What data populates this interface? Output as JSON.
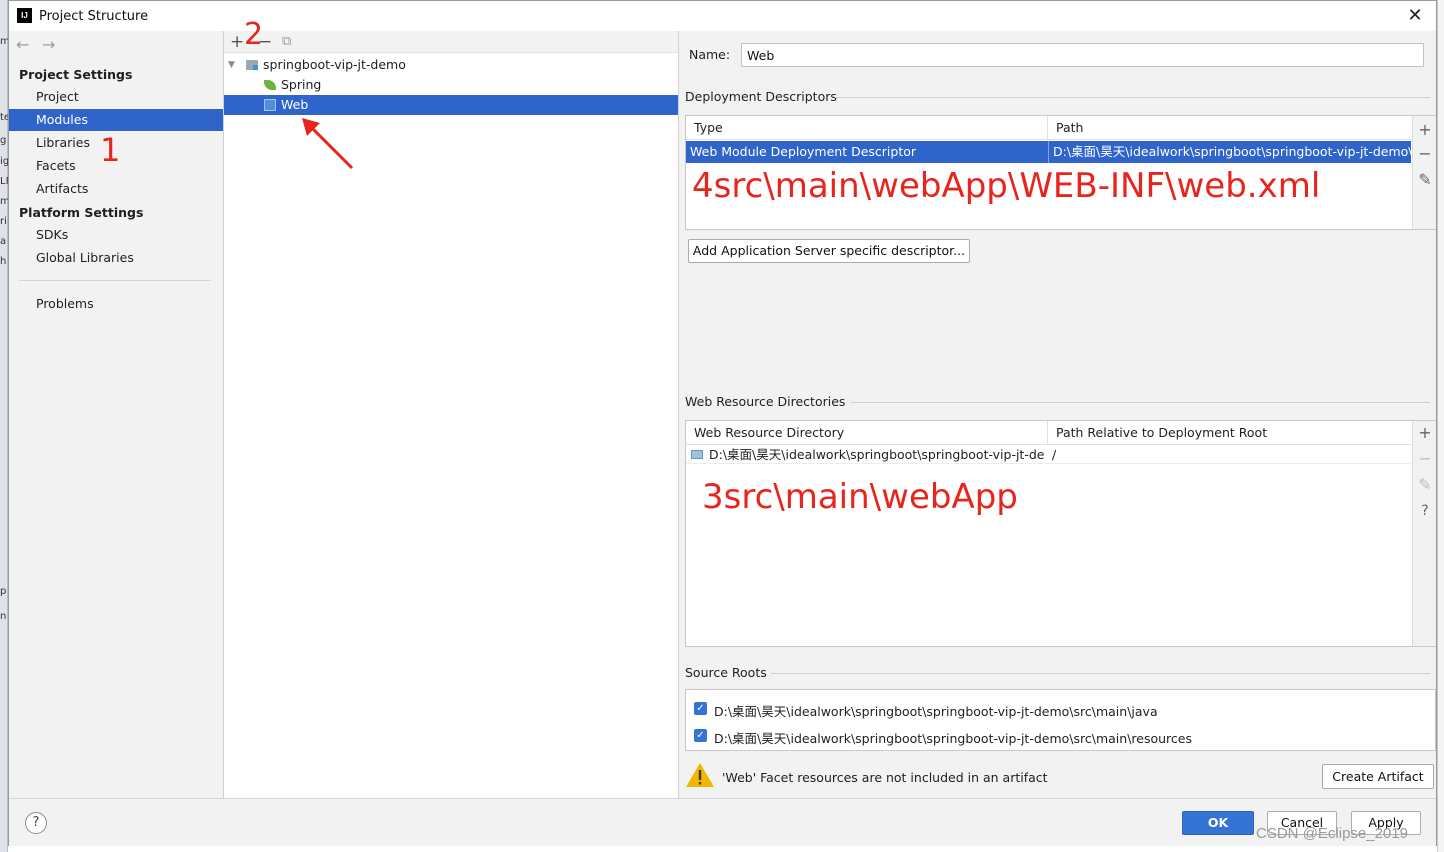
{
  "window": {
    "title": "Project Structure",
    "app_logo": "IJ",
    "close_glyph": "✕"
  },
  "nav": {
    "back_glyph": "←",
    "forward_glyph": "→",
    "project_settings_header": "Project Settings",
    "project_settings_items": [
      "Project",
      "Modules",
      "Libraries",
      "Facets",
      "Artifacts"
    ],
    "platform_settings_header": "Platform Settings",
    "platform_settings_items": [
      "SDKs",
      "Global Libraries"
    ],
    "problems": "Problems",
    "selected": "Modules"
  },
  "tree": {
    "toolbar": {
      "add_glyph": "+",
      "remove_glyph": "−",
      "copy_glyph": "⧉"
    },
    "root": "springboot-vip-jt-demo",
    "children": [
      "Spring",
      "Web"
    ],
    "selected": "Web"
  },
  "details": {
    "name_label": "Name:",
    "name_value": "Web",
    "deployment_descriptors": {
      "section_title": "Deployment Descriptors",
      "columns": [
        "Type",
        "Path"
      ],
      "rows": [
        {
          "type": "Web Module Deployment Descriptor",
          "path": "D:\\桌面\\昊天\\idealwork\\springboot\\springboot-vip-jt-demo\\src\\main\\webApp\\WEB-INF\\web.xml"
        }
      ],
      "add_descriptor_button": "Add Application Server specific descriptor..."
    },
    "web_resource_directories": {
      "section_title": "Web Resource Directories",
      "columns": [
        "Web Resource Directory",
        "Path Relative to Deployment Root"
      ],
      "rows": [
        {
          "directory": "D:\\桌面\\昊天\\idealwork\\springboot\\springboot-vip-jt-de...",
          "relative": "/"
        }
      ]
    },
    "source_roots": {
      "section_title": "Source Roots",
      "items": [
        {
          "path": "D:\\桌面\\昊天\\idealwork\\springboot\\springboot-vip-jt-demo\\src\\main\\java",
          "checked": true
        },
        {
          "path": "D:\\桌面\\昊天\\idealwork\\springboot\\springboot-vip-jt-demo\\src\\main\\resources",
          "checked": true
        }
      ]
    },
    "warning_text": "'Web' Facet resources are not included in an artifact",
    "create_artifact_button": "Create Artifact"
  },
  "side_tools": {
    "add": "+",
    "remove": "−",
    "edit": "✎",
    "help": "?"
  },
  "footer": {
    "help_glyph": "?",
    "ok": "OK",
    "cancel": "Cancel",
    "apply": "Apply"
  },
  "annotations": {
    "step1": "1",
    "step2": "2",
    "step3": "3src\\main\\webApp",
    "step4": "4src\\main\\webApp\\WEB-INF\\web.xml",
    "color": "#e8241c"
  },
  "watermark": "CSDN @Eclipse_2019",
  "colors": {
    "selection": "#2f65ca",
    "primary_button": "#3574d4",
    "warning": "#f2b600"
  }
}
